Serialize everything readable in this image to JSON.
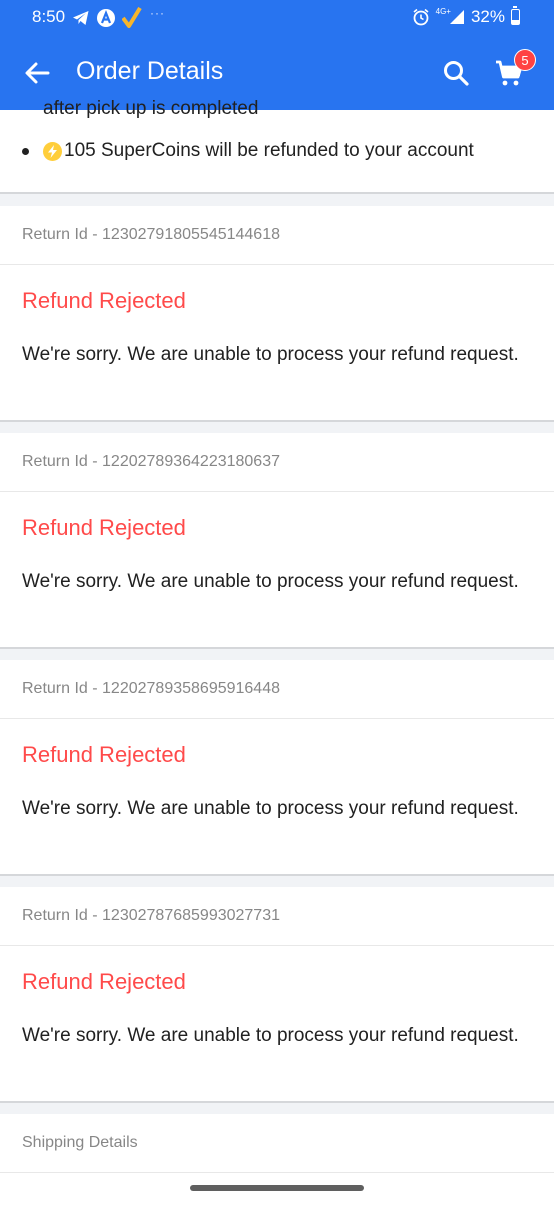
{
  "status_bar": {
    "time": "8:50",
    "dots": "···",
    "network": "4G+",
    "battery": "32%",
    "battery_level": 0.32
  },
  "app_bar": {
    "title": "Order Details",
    "cart_count": "5",
    "back_icon": "arrow-left-icon",
    "search_icon": "search-icon",
    "cart_icon": "cart-icon"
  },
  "info": {
    "partial_line": "after pick up is completed",
    "supercoins_line": "105 SuperCoins will be refunded to your account"
  },
  "returns": [
    {
      "return_id": "Return Id - 12302791805545144618",
      "status": "Refund Rejected",
      "message": "We're sorry. We are unable to process your refund request."
    },
    {
      "return_id": "Return Id - 12202789364223180637",
      "status": "Refund Rejected",
      "message": "We're sorry. We are unable to process your refund request."
    },
    {
      "return_id": "Return Id - 12202789358695916448",
      "status": "Refund Rejected",
      "message": "We're sorry. We are unable to process your refund request."
    },
    {
      "return_id": "Return Id - 12302787685993027731",
      "status": "Refund Rejected",
      "message": "We're sorry. We are unable to process your refund request."
    }
  ],
  "shipping": {
    "title": "Shipping Details"
  },
  "colors": {
    "brand_blue": "#2874f0",
    "rejected_red": "#ff4a4a",
    "badge_red": "#ff4343",
    "coin_yellow": "#ffce3b"
  }
}
